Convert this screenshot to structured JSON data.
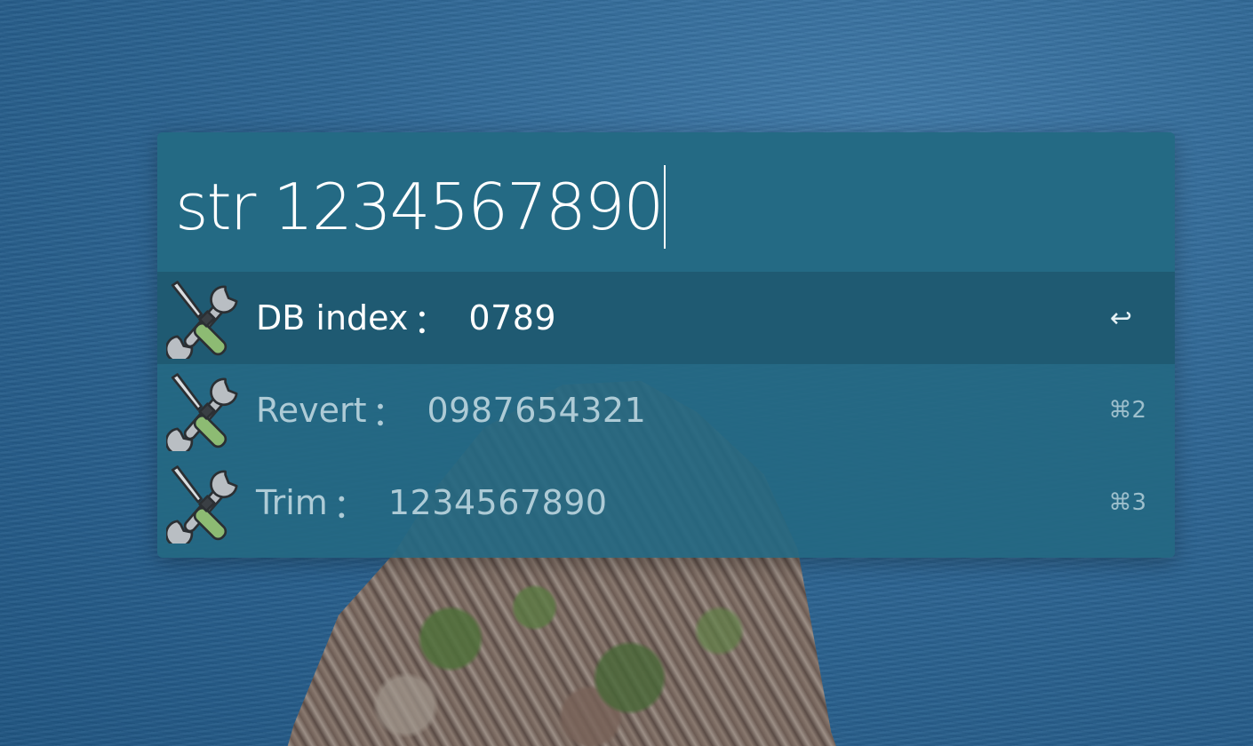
{
  "launcher": {
    "query": "str 1234567890",
    "results": [
      {
        "title": "DB index",
        "separator": "：",
        "value": "0789",
        "shortcut": "↩",
        "icon": "tools-icon",
        "selected": true
      },
      {
        "title": "Revert",
        "separator": "：",
        "value": "0987654321",
        "shortcut": "⌘2",
        "icon": "tools-icon",
        "selected": false
      },
      {
        "title": "Trim",
        "separator": "：",
        "value": "1234567890",
        "shortcut": "⌘3",
        "icon": "tools-icon",
        "selected": false
      }
    ]
  },
  "colors": {
    "panel": "#246a84",
    "selected_row": "#1f5a72",
    "text_primary": "#ffffff",
    "text_secondary": "#aecbd6"
  }
}
